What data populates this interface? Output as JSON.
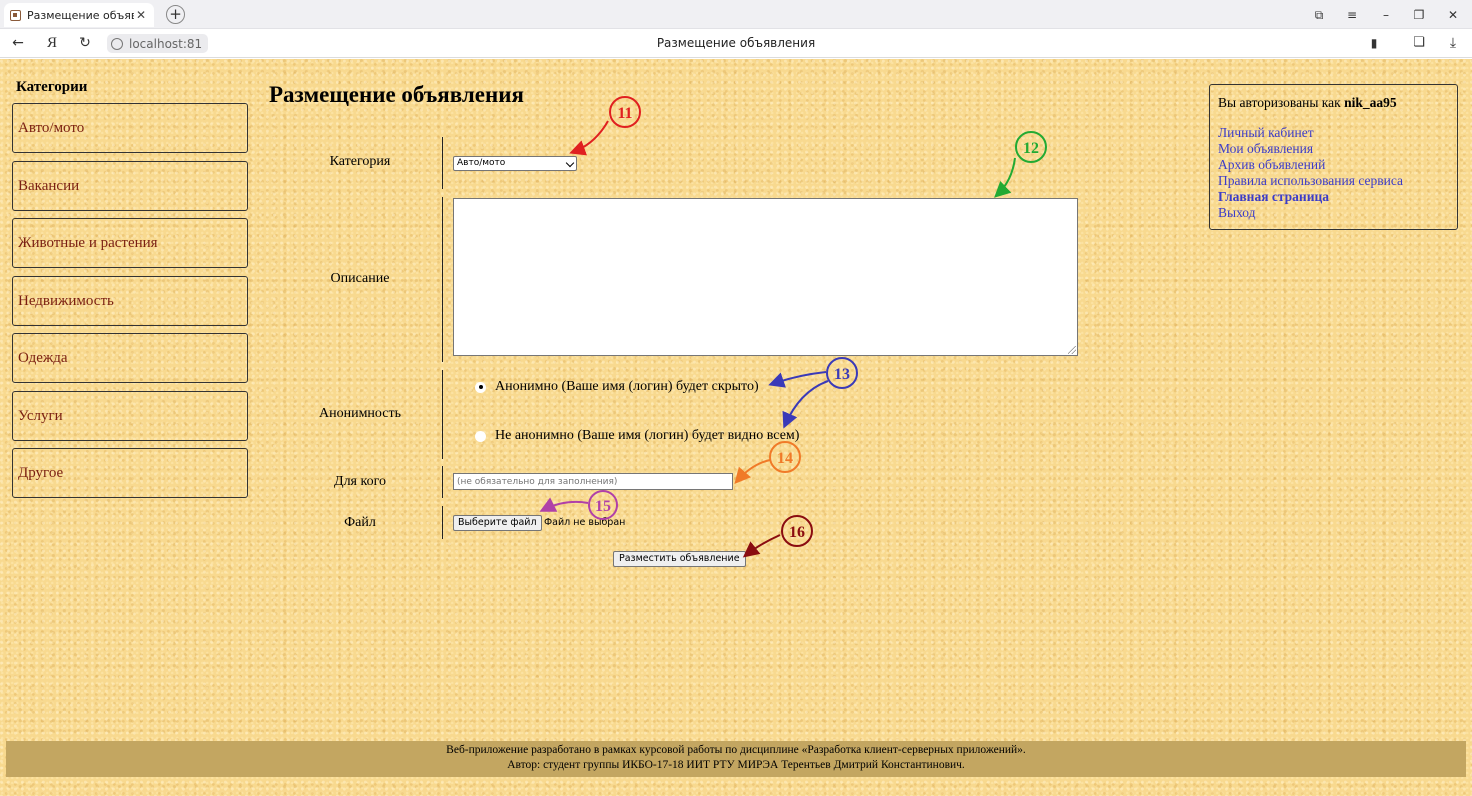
{
  "browser": {
    "tab_title": "Размещение объявлени",
    "url": "localhost:81",
    "page_title": "Размещение объявления"
  },
  "sidebar": {
    "heading": "Категории",
    "items": [
      {
        "label": "Авто/мото"
      },
      {
        "label": "Вакансии"
      },
      {
        "label": "Животные и растения"
      },
      {
        "label": "Недвижимость"
      },
      {
        "label": "Одежда"
      },
      {
        "label": "Услуги"
      },
      {
        "label": "Другое"
      }
    ]
  },
  "main": {
    "title": "Размещение объявления",
    "form": {
      "category_label": "Категория",
      "category_value": "Авто/мото",
      "description_label": "Описание",
      "description_value": "",
      "anonymity_label": "Анонимность",
      "anonymity_options": [
        {
          "label": "Анонимно (Ваше имя (логин) будет скрыто)",
          "checked": true
        },
        {
          "label": "Не анонимно (Ваше имя (логин) будет видно всем)",
          "checked": false
        }
      ],
      "for_whom_label": "Для кого",
      "for_whom_placeholder": "(не обязательно для заполнения)",
      "file_label": "Файл",
      "file_button": "Выберите файл",
      "file_status": "Файл не выбран",
      "submit_label": "Разместить объявление"
    }
  },
  "user_panel": {
    "auth_prefix": "Вы авторизованы как",
    "username": "nik_aa95",
    "links": [
      {
        "label": "Личный кабинет"
      },
      {
        "label": "Мои объявления"
      },
      {
        "label": "Архив объявлений"
      },
      {
        "label": "Правила использования сервиса"
      },
      {
        "label": "Главная страница"
      },
      {
        "label": "Выход"
      }
    ]
  },
  "footer": {
    "line1": "Веб-приложение разработано в рамках курсовой работы по дисциплине «Разработка клиент-серверных приложений».",
    "line2": "Автор: студент группы ИКБО-17-18 ИИТ РТУ МИРЭА Терентьев Дмитрий Константинович."
  },
  "annotations": [
    {
      "number": "11",
      "color": "#e02020"
    },
    {
      "number": "12",
      "color": "#22aa33"
    },
    {
      "number": "13",
      "color": "#3a3ab8"
    },
    {
      "number": "14",
      "color": "#f07a28"
    },
    {
      "number": "15",
      "color": "#b040a8"
    },
    {
      "number": "16",
      "color": "#8a0c10"
    }
  ]
}
